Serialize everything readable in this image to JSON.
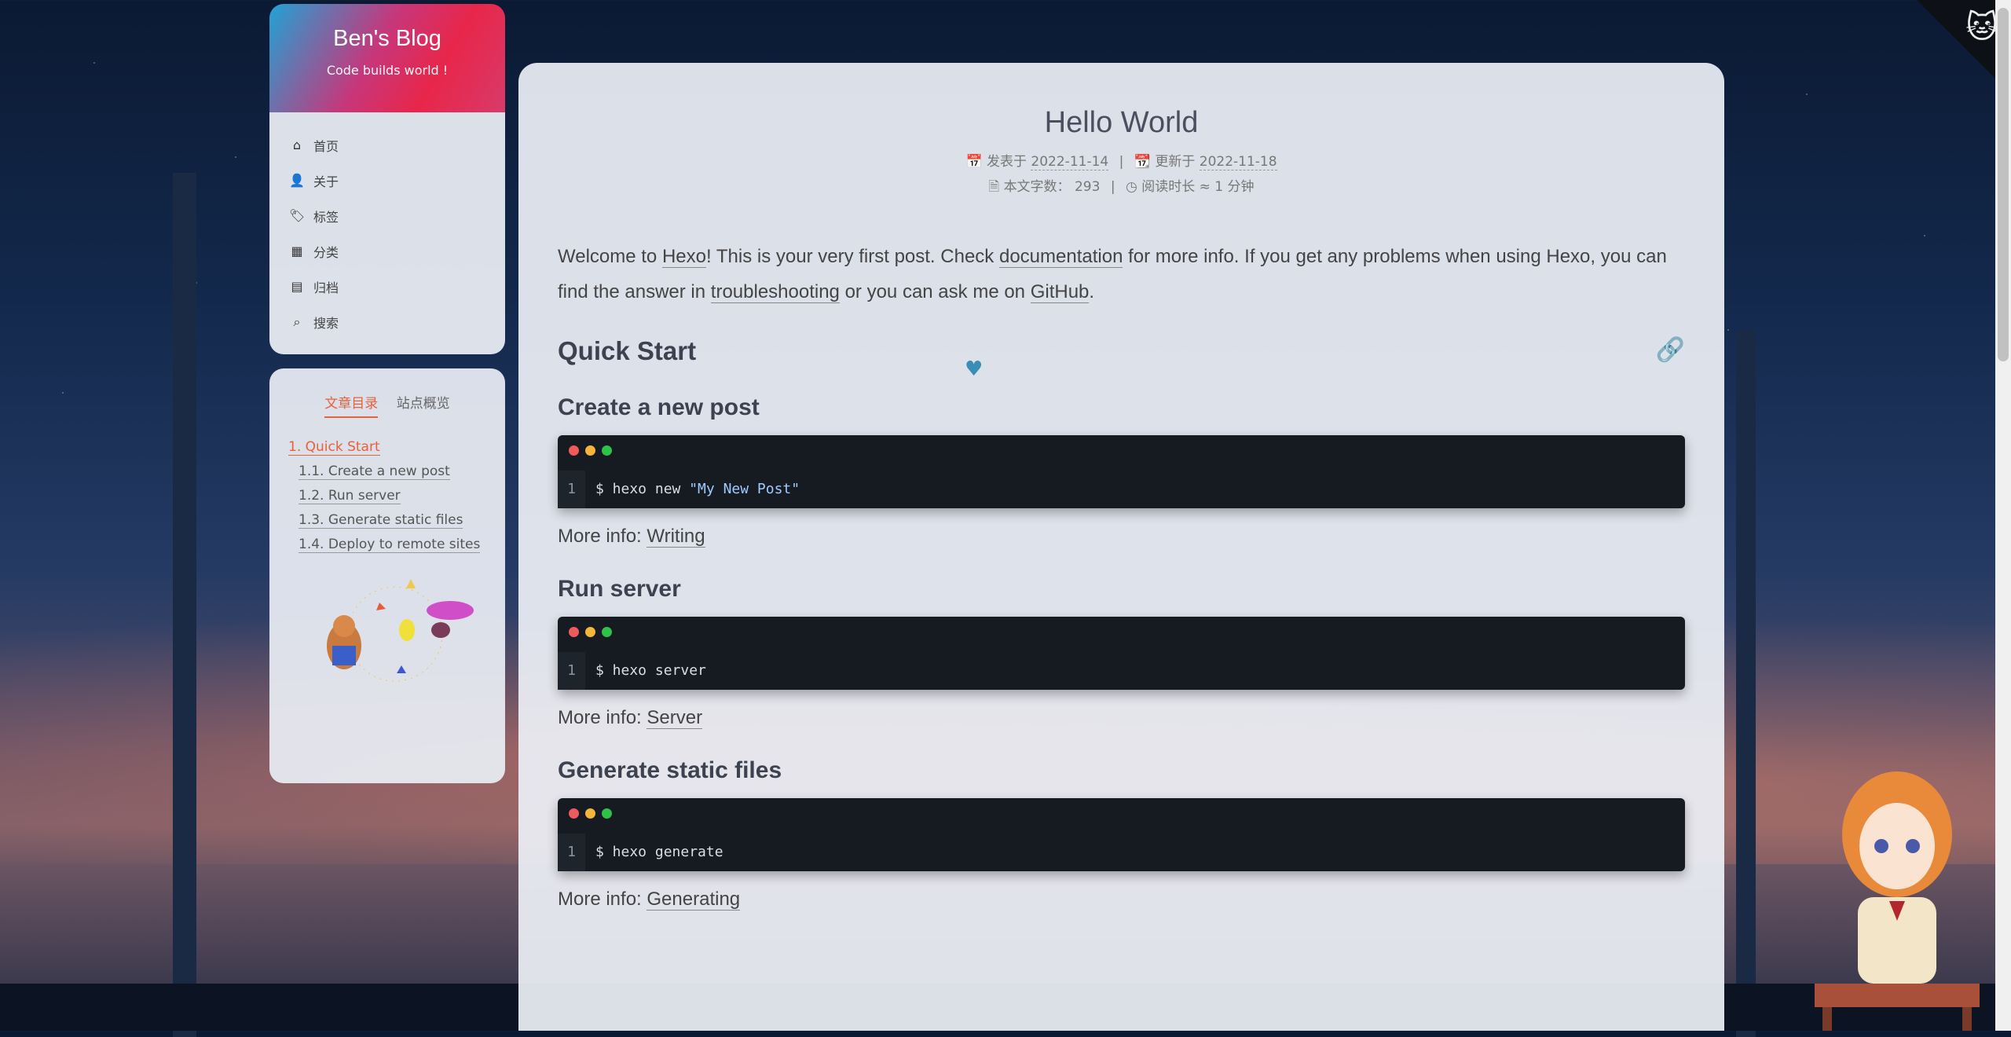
{
  "site": {
    "title": "Ben's Blog",
    "subtitle": "Code builds world !"
  },
  "nav": {
    "items": [
      {
        "label": "首页",
        "icon": "home-icon"
      },
      {
        "label": "关于",
        "icon": "user-icon"
      },
      {
        "label": "标签",
        "icon": "tags-icon"
      },
      {
        "label": "分类",
        "icon": "grid-icon"
      },
      {
        "label": "归档",
        "icon": "archive-icon"
      },
      {
        "label": "搜索",
        "icon": "search-icon"
      }
    ]
  },
  "toc": {
    "tabs": [
      "文章目录",
      "站点概览"
    ],
    "items": [
      "1. Quick Start",
      "1.1. Create a new post",
      "1.2. Run server",
      "1.3. Generate static files",
      "1.4. Deploy to remote sites"
    ]
  },
  "post": {
    "title": "Hello World",
    "posted_label": "发表于",
    "posted_date": "2022-11-14",
    "updated_label": "更新于",
    "updated_date": "2022-11-18",
    "wordcount_label": "本文字数：",
    "wordcount": "293",
    "readtime_label": "阅读时长 ≈",
    "readtime": "1 分钟",
    "intro": {
      "p1": "Welcome to ",
      "hexo": "Hexo",
      "p2": "! This is your very first post. Check ",
      "docs": "documentation",
      "p3": " for more info. If you get any problems when using Hexo, you can find the answer in ",
      "trouble": "troubleshooting",
      "p4": " or you can ask me on ",
      "github": "GitHub",
      "p5": "."
    },
    "sections": {
      "quick_start": "Quick Start",
      "create": "Create a new post",
      "create_cmd": "$ hexo new ",
      "create_str": "\"My New Post\"",
      "create_more": "More info: ",
      "create_link": "Writing",
      "run": "Run server",
      "run_cmd": "$ hexo server",
      "run_more": "More info: ",
      "run_link": "Server",
      "gen": "Generate static files",
      "gen_cmd": "$ hexo generate",
      "gen_more": "More info: ",
      "gen_link": "Generating",
      "line_no": "1"
    }
  },
  "colors": {
    "accent": "#e8603c",
    "code_bg": "#161b22",
    "dot_red": "#ef5b5b",
    "dot_yellow": "#f5b53a",
    "dot_green": "#2fc24a"
  }
}
